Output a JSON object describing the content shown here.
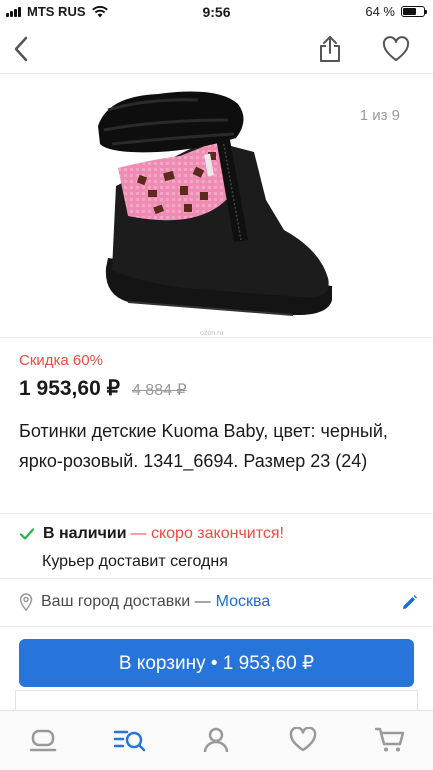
{
  "status_bar": {
    "carrier": "MTS RUS",
    "time": "9:56",
    "battery": "64 %",
    "battery_level": 0.64
  },
  "nav": {
    "back_icon": "chevron-left-icon",
    "share_icon": "share-icon",
    "favorite_icon": "heart-icon"
  },
  "gallery": {
    "counter": "1 из 9",
    "watermark": "ozon.ru"
  },
  "product": {
    "discount": "Скидка 60%",
    "price": "1 953,60 ₽",
    "old_price": "4 884 ₽",
    "title": "Ботинки детские Kuoma Baby, цвет: черный, ярко-розовый. 1341_6694. Размер 23 (24)"
  },
  "availability": {
    "label": "В наличии",
    "note": "— скоро закончится!",
    "courier": "Курьер доставит сегодня"
  },
  "delivery": {
    "label": "Ваш город доставки —",
    "city": "Москва"
  },
  "cart_button": {
    "label": "В корзину • 1 953,60 ₽"
  },
  "tab_bar": {
    "items": [
      "home-icon",
      "catalog-search-icon",
      "profile-icon",
      "favorites-icon",
      "cart-icon"
    ]
  },
  "colors": {
    "accent": "#2775db",
    "discount": "#f04b3e",
    "success": "#2bb24c"
  }
}
